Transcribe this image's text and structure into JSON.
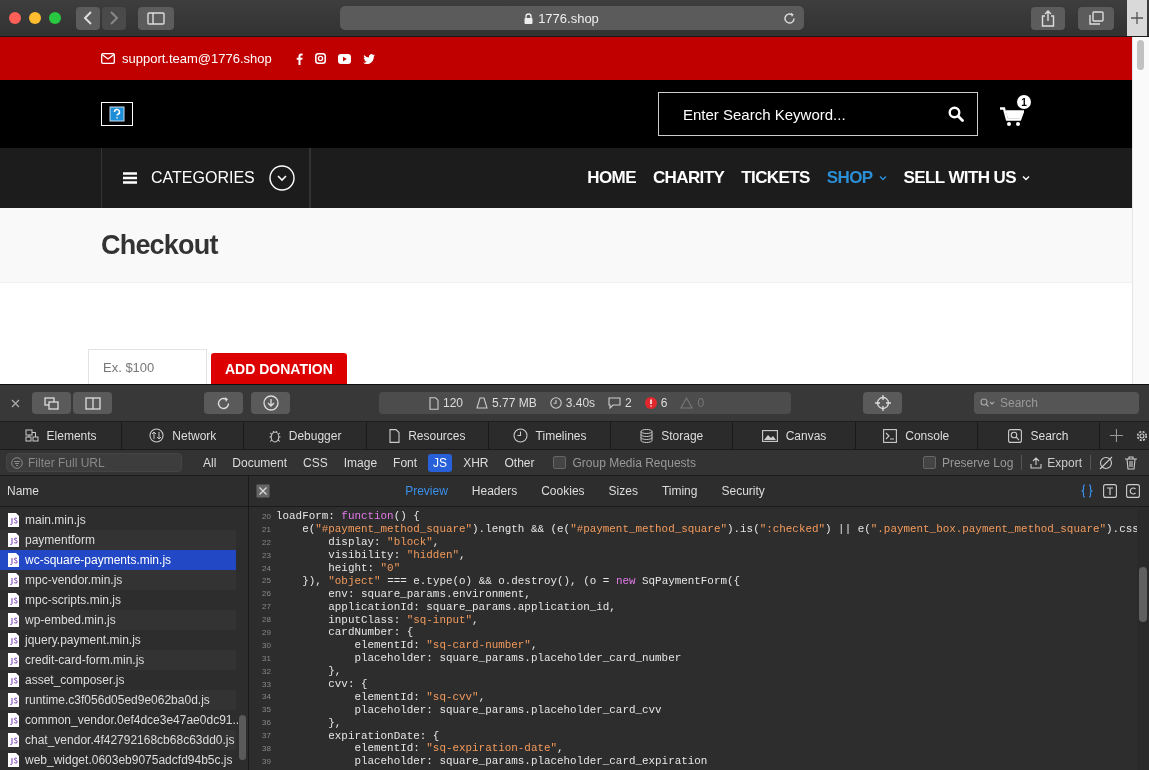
{
  "browser": {
    "address": "1776.shop"
  },
  "site": {
    "email": "support.team@1776.shop",
    "search": {
      "placeholder": "Enter Search Keyword..."
    },
    "cart": {
      "count": "1"
    },
    "categories": "CATEGORIES",
    "menu": [
      {
        "label": "HOME",
        "selected": false,
        "dropdown": false
      },
      {
        "label": "CHARITY",
        "selected": false,
        "dropdown": false
      },
      {
        "label": "TICKETS",
        "selected": false,
        "dropdown": false
      },
      {
        "label": "SHOP",
        "selected": true,
        "dropdown": true
      },
      {
        "label": "SELL WITH US",
        "selected": false,
        "dropdown": true
      }
    ],
    "page_title": "Checkout",
    "donation": {
      "placeholder": "Ex. $100",
      "button": "ADD DONATION"
    }
  },
  "devtools": {
    "stats": [
      {
        "kind": "resources",
        "text": "120"
      },
      {
        "kind": "size",
        "text": "5.77 MB"
      },
      {
        "kind": "time",
        "text": "3.40s"
      },
      {
        "kind": "logs",
        "text": "2"
      },
      {
        "kind": "errors",
        "text": "6"
      },
      {
        "kind": "warnings",
        "text": "0"
      }
    ],
    "search": {
      "placeholder": "Search"
    },
    "tabs": [
      {
        "kind": "elements",
        "label": "Elements"
      },
      {
        "kind": "network",
        "label": "Network"
      },
      {
        "kind": "debugger",
        "label": "Debugger"
      },
      {
        "kind": "resources",
        "label": "Resources"
      },
      {
        "kind": "timelines",
        "label": "Timelines"
      },
      {
        "kind": "storage",
        "label": "Storage"
      },
      {
        "kind": "canvas",
        "label": "Canvas"
      },
      {
        "kind": "console",
        "label": "Console"
      },
      {
        "kind": "search",
        "label": "Search"
      }
    ],
    "filter": {
      "placeholder": "Filter Full URL"
    },
    "types": [
      {
        "label": "All",
        "selected": false
      },
      {
        "label": "Document",
        "selected": false
      },
      {
        "label": "CSS",
        "selected": false
      },
      {
        "label": "Image",
        "selected": false
      },
      {
        "label": "Font",
        "selected": false
      },
      {
        "label": "JS",
        "selected": true
      },
      {
        "label": "XHR",
        "selected": false
      },
      {
        "label": "Other",
        "selected": false
      }
    ],
    "group_media": {
      "label": "Group Media Requests",
      "checked": false
    },
    "preserve_log": {
      "label": "Preserve Log",
      "checked": false
    },
    "export": "Export",
    "name_header": "Name",
    "detail_tabs": [
      {
        "label": "Preview",
        "selected": true
      },
      {
        "label": "Headers",
        "selected": false
      },
      {
        "label": "Cookies",
        "selected": false
      },
      {
        "label": "Sizes",
        "selected": false
      },
      {
        "label": "Timing",
        "selected": false
      },
      {
        "label": "Security",
        "selected": false
      }
    ],
    "files": [
      {
        "name": "main.min.js",
        "selected": false
      },
      {
        "name": "paymentform",
        "selected": false
      },
      {
        "name": "wc-square-payments.min.js",
        "selected": true
      },
      {
        "name": "mpc-vendor.min.js",
        "selected": false
      },
      {
        "name": "mpc-scripts.min.js",
        "selected": false
      },
      {
        "name": "wp-embed.min.js",
        "selected": false
      },
      {
        "name": "jquery.payment.min.js",
        "selected": false
      },
      {
        "name": "credit-card-form.min.js",
        "selected": false
      },
      {
        "name": "asset_composer.js",
        "selected": false
      },
      {
        "name": "runtime.c3f056d05ed9e062ba0d.js",
        "selected": false
      },
      {
        "name": "common_vendor.0ef4dce3e47ae0dc91..",
        "selected": false
      },
      {
        "name": "chat_vendor.4f42792168cb68c63dd0.js",
        "selected": false
      },
      {
        "name": "web_widget.0603eb9075adcfd94b5c.js",
        "selected": false
      }
    ],
    "code": [
      {
        "number": "20",
        "tokens": [
          {
            "kind": "plain",
            "text": "loadForm: "
          },
          {
            "kind": "keyword",
            "text": "function"
          },
          {
            "kind": "plain",
            "text": "() {"
          }
        ]
      },
      {
        "number": "21",
        "tokens": [
          {
            "kind": "plain",
            "text": "    e("
          },
          {
            "kind": "string",
            "text": "\"#payment_method_square\""
          },
          {
            "kind": "plain",
            "text": ").length && (e("
          },
          {
            "kind": "string",
            "text": "\"#payment_method_square\""
          },
          {
            "kind": "plain",
            "text": ").is("
          },
          {
            "kind": "string",
            "text": "\":checked\""
          },
          {
            "kind": "plain",
            "text": ") || e("
          },
          {
            "kind": "string",
            "text": "\".payment_box.payment_method_square\""
          },
          {
            "kind": "plain",
            "text": ").css"
          }
        ]
      },
      {
        "number": "22",
        "tokens": [
          {
            "kind": "plain",
            "text": "        display: "
          },
          {
            "kind": "string",
            "text": "\"block\""
          },
          {
            "kind": "plain",
            "text": ","
          }
        ]
      },
      {
        "number": "23",
        "tokens": [
          {
            "kind": "plain",
            "text": "        visibility: "
          },
          {
            "kind": "string",
            "text": "\"hidden\""
          },
          {
            "kind": "plain",
            "text": ","
          }
        ]
      },
      {
        "number": "24",
        "tokens": [
          {
            "kind": "plain",
            "text": "        height: "
          },
          {
            "kind": "string",
            "text": "\"0\""
          }
        ]
      },
      {
        "number": "25",
        "tokens": [
          {
            "kind": "plain",
            "text": "    }), "
          },
          {
            "kind": "string",
            "text": "\"object\""
          },
          {
            "kind": "plain",
            "text": " === e.type(o) && o.destroy(), (o = "
          },
          {
            "kind": "keyword",
            "text": "new"
          },
          {
            "kind": "plain",
            "text": " SqPaymentForm({"
          }
        ]
      },
      {
        "number": "26",
        "tokens": [
          {
            "kind": "plain",
            "text": "        env: square_params.environment,"
          }
        ]
      },
      {
        "number": "27",
        "tokens": [
          {
            "kind": "plain",
            "text": "        applicationId: square_params.application_id,"
          }
        ]
      },
      {
        "number": "28",
        "tokens": [
          {
            "kind": "plain",
            "text": "        inputClass: "
          },
          {
            "kind": "string",
            "text": "\"sq-input\""
          },
          {
            "kind": "plain",
            "text": ","
          }
        ]
      },
      {
        "number": "29",
        "tokens": [
          {
            "kind": "plain",
            "text": "        cardNumber: {"
          }
        ]
      },
      {
        "number": "30",
        "tokens": [
          {
            "kind": "plain",
            "text": "            elementId: "
          },
          {
            "kind": "string",
            "text": "\"sq-card-number\""
          },
          {
            "kind": "plain",
            "text": ","
          }
        ]
      },
      {
        "number": "31",
        "tokens": [
          {
            "kind": "plain",
            "text": "            placeholder: square_params.placeholder_card_number"
          }
        ]
      },
      {
        "number": "32",
        "tokens": [
          {
            "kind": "plain",
            "text": "        },"
          }
        ]
      },
      {
        "number": "33",
        "tokens": [
          {
            "kind": "plain",
            "text": "        cvv: {"
          }
        ]
      },
      {
        "number": "34",
        "tokens": [
          {
            "kind": "plain",
            "text": "            elementId: "
          },
          {
            "kind": "string",
            "text": "\"sq-cvv\""
          },
          {
            "kind": "plain",
            "text": ","
          }
        ]
      },
      {
        "number": "35",
        "tokens": [
          {
            "kind": "plain",
            "text": "            placeholder: square_params.placeholder_card_cvv"
          }
        ]
      },
      {
        "number": "36",
        "tokens": [
          {
            "kind": "plain",
            "text": "        },"
          }
        ]
      },
      {
        "number": "37",
        "tokens": [
          {
            "kind": "plain",
            "text": "        expirationDate: {"
          }
        ]
      },
      {
        "number": "38",
        "tokens": [
          {
            "kind": "plain",
            "text": "            elementId: "
          },
          {
            "kind": "string",
            "text": "\"sq-expiration-date\""
          },
          {
            "kind": "plain",
            "text": ","
          }
        ]
      },
      {
        "number": "39",
        "tokens": [
          {
            "kind": "plain",
            "text": "            placeholder: square_params.placeholder_card_expiration"
          }
        ]
      }
    ]
  }
}
